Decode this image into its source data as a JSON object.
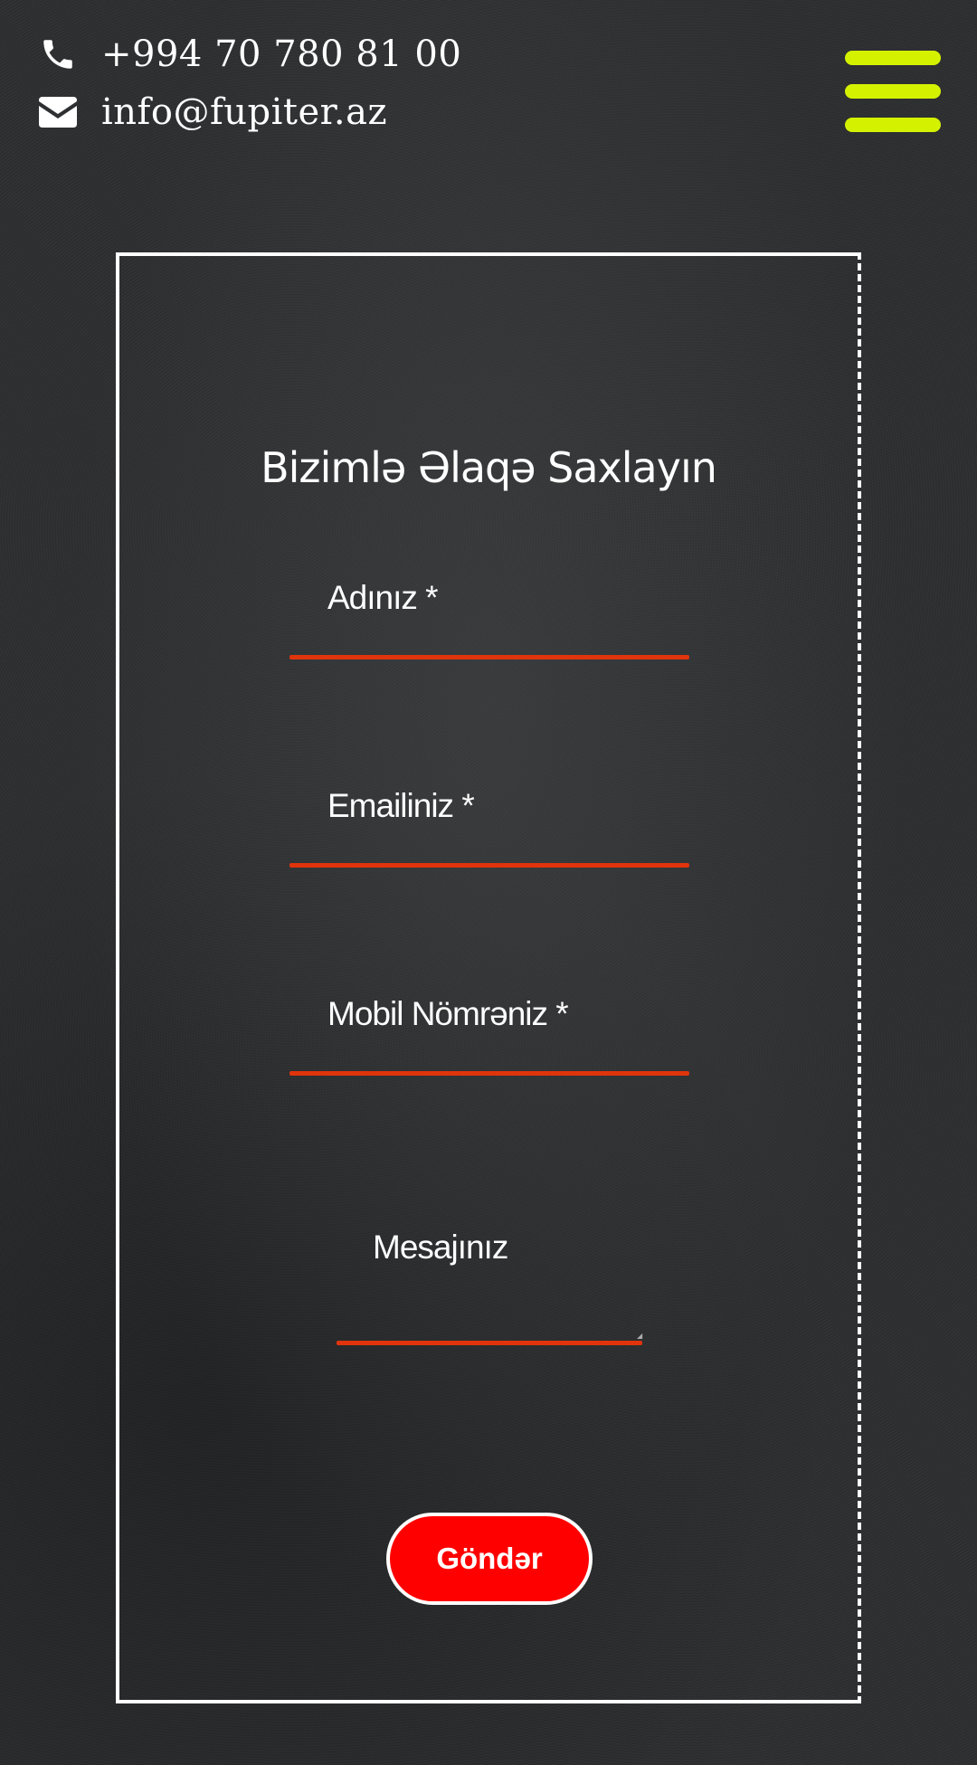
{
  "header": {
    "phone": {
      "icon": "phone-icon",
      "text": "+994 70 780 81 00"
    },
    "email": {
      "icon": "envelope-icon",
      "text": "info@fupiter.az"
    },
    "menu": {
      "icon": "hamburger-menu-icon"
    }
  },
  "form": {
    "title": "Bizimlə Əlaqə Saxlayın",
    "fields": {
      "name": {
        "label": "Adınız *",
        "value": ""
      },
      "email": {
        "label": "Emailiniz *",
        "value": ""
      },
      "mobile": {
        "label": "Mobil Nömrəniz *",
        "value": ""
      },
      "message": {
        "label": "Mesajınız",
        "value": ""
      }
    },
    "submit_label": "Göndər"
  },
  "colors": {
    "background": "#2b2d2f",
    "menu_accent": "#d4f200",
    "field_underline": "#e0340c",
    "submit_background": "#ff0000",
    "text": "#ffffff"
  }
}
